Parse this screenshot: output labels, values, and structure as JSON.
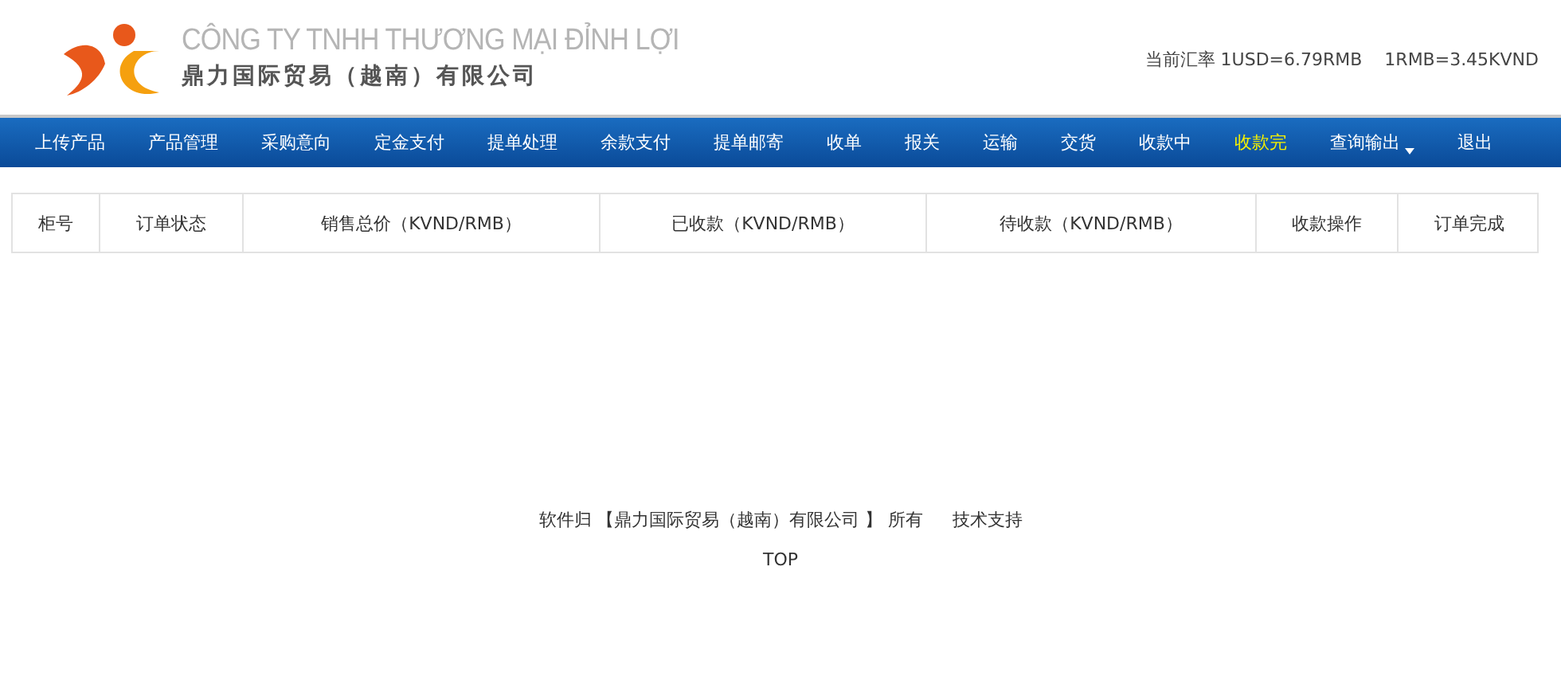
{
  "header": {
    "company_vn": "CÔNG TY TNHH THƯƠNG MẠI ĐỈNH LỢI",
    "company_cn": "鼎力国际贸易（越南）有限公司",
    "exchange_rate": "当前汇率 1USD=6.79RMB    1RMB=3.45KVND"
  },
  "nav": [
    {
      "label": "上传产品",
      "selected": false,
      "dropdown": false
    },
    {
      "label": "产品管理",
      "selected": false,
      "dropdown": false
    },
    {
      "label": "采购意向",
      "selected": false,
      "dropdown": false
    },
    {
      "label": "定金支付",
      "selected": false,
      "dropdown": false
    },
    {
      "label": "提单处理",
      "selected": false,
      "dropdown": false
    },
    {
      "label": "余款支付",
      "selected": false,
      "dropdown": false
    },
    {
      "label": "提单邮寄",
      "selected": false,
      "dropdown": false
    },
    {
      "label": "收单",
      "selected": false,
      "dropdown": false
    },
    {
      "label": "报关",
      "selected": false,
      "dropdown": false
    },
    {
      "label": "运输",
      "selected": false,
      "dropdown": false
    },
    {
      "label": "交货",
      "selected": false,
      "dropdown": false
    },
    {
      "label": "收款中",
      "selected": false,
      "dropdown": false
    },
    {
      "label": "收款完",
      "selected": true,
      "dropdown": false
    },
    {
      "label": "查询输出",
      "selected": false,
      "dropdown": true
    },
    {
      "label": "退出",
      "selected": false,
      "dropdown": false
    }
  ],
  "table": {
    "columns": [
      "柜号",
      "订单状态",
      "销售总价（KVND/RMB）",
      "已收款（KVND/RMB）",
      "待收款（KVND/RMB）",
      "收款操作",
      "订单完成"
    ]
  },
  "footer": {
    "ownership": "软件归 【鼎力国际贸易（越南）有限公司 】 所有",
    "support": "技术支持",
    "top": "TOP"
  }
}
